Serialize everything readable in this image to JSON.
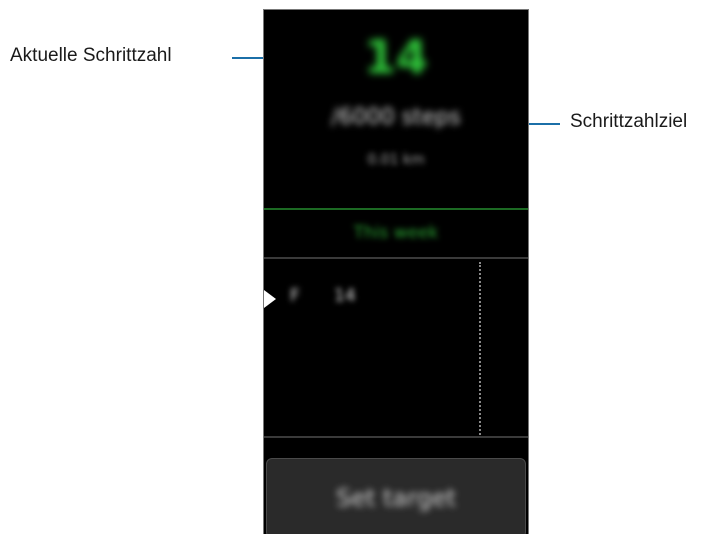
{
  "callouts": {
    "current_steps": "Aktuelle Schrittzahl",
    "step_goal": "Schrittzahlziel"
  },
  "screen": {
    "step_count": "14",
    "step_goal_text": "/6000 steps",
    "distance_text": "0.01 km",
    "section_label": "This week",
    "week_rows": [
      {
        "day": "F",
        "steps": "14"
      }
    ],
    "set_target_label": "Set target"
  },
  "colors": {
    "accent_green": "#2fc43a",
    "callout_line": "#1b6fa8",
    "screen_background": "#000000"
  }
}
